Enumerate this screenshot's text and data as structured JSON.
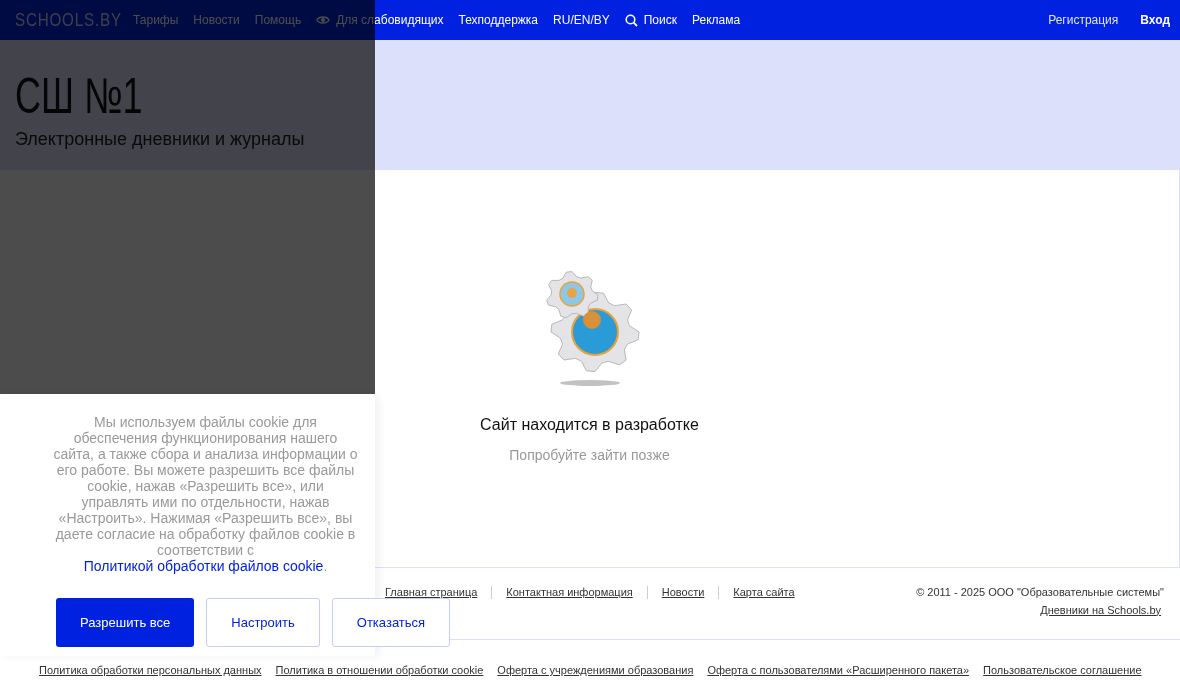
{
  "nav": {
    "logo": "SCHOOLS.BY",
    "items": [
      {
        "kind": "text",
        "label": "Тарифы"
      },
      {
        "kind": "text",
        "label": "Новости"
      },
      {
        "kind": "text",
        "label": "Помощь"
      },
      {
        "kind": "eye",
        "label": "Для слабовидящих"
      },
      {
        "kind": "text",
        "label": "Техподдержка"
      },
      {
        "kind": "text",
        "label": "RU/EN/BY"
      },
      {
        "kind": "search",
        "label": "Поиск"
      },
      {
        "kind": "text",
        "label": "Реклама"
      }
    ],
    "auth": [
      {
        "kind": "link",
        "label": "Регистрация"
      },
      {
        "kind": "primary",
        "label": "Вход"
      }
    ]
  },
  "header": {
    "title": "СШ №1",
    "subtitle": "Электронные дневники и журналы"
  },
  "notice": {
    "title": "Сайт находится в разработке",
    "subtitle": "Попробуйте зайти позже"
  },
  "footer": {
    "links": [
      "Главная страница",
      "Контактная информация",
      "Новости",
      "Карта сайта"
    ],
    "copyright": "© 2011 - 2025 ООО \"Образовательные системы\"",
    "site_link": "Дневники на Schools.by",
    "bottom_links": [
      "Политика обработки персональных данных",
      "Политика в отношении обработки cookie",
      "Оферта с учреждениями образования",
      "Оферта с пользователями «Расширенного пакета»",
      "Пользовательское соглашение"
    ]
  },
  "cookie_banner": {
    "backdrop": true,
    "text": "Мы используем файлы cookie для обеспечения функционирования нашего сайта, а также сбора и анализа информации о его работе. Вы можете разрешить все файлы cookie, нажав «Разрешить все», или управлять ими по отдельности, нажав «Настроить». Нажимая «Разрешить все», вы даете согласие на обработку файлов cookie в соответствии с ",
    "link": "Политикой обработки файлов cookie",
    "text_end": ".",
    "buttons": [
      {
        "kind": "primary",
        "label": "Разрешить все"
      },
      {
        "kind": "outline",
        "label": "Настроить"
      },
      {
        "kind": "outline",
        "label": "Отказаться"
      }
    ]
  }
}
